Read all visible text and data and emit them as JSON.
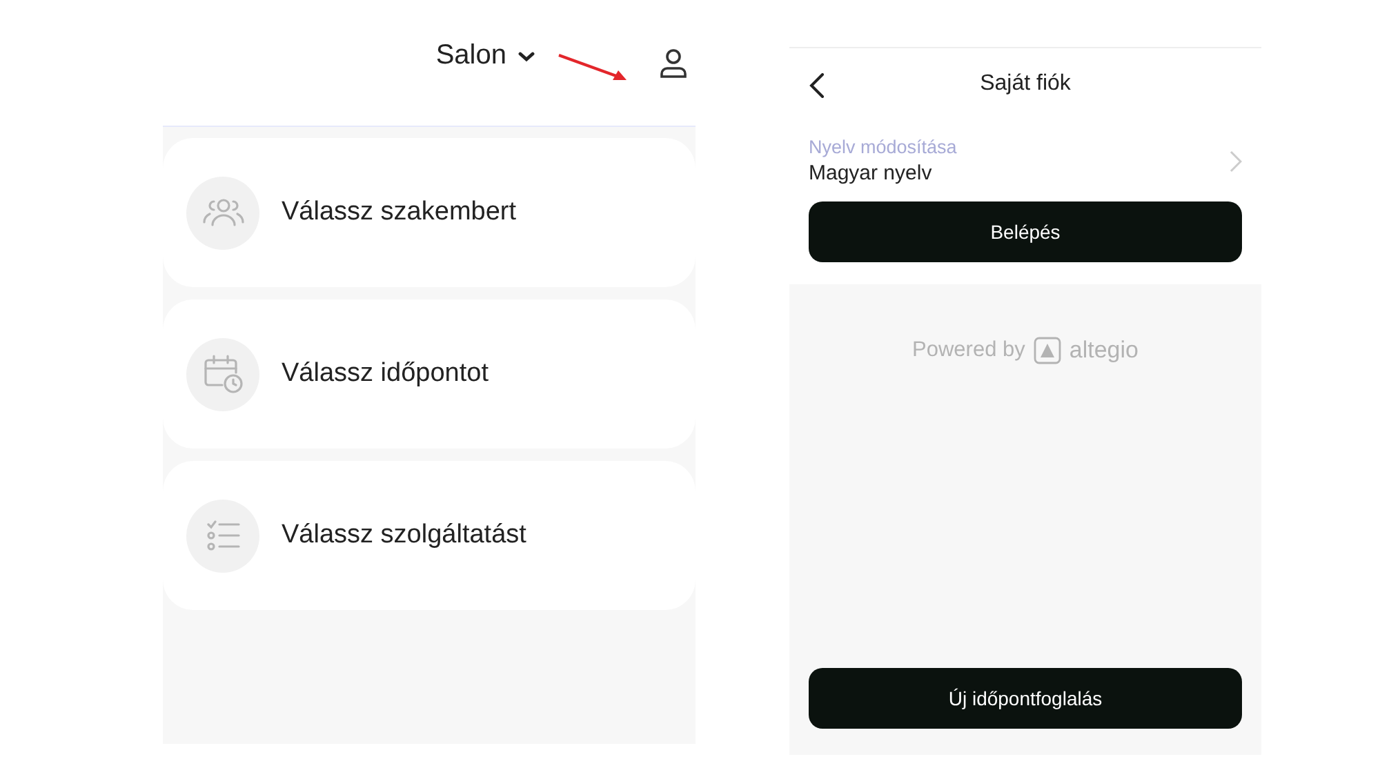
{
  "booking_screen": {
    "salon_selector": {
      "label": "Salon"
    },
    "options": [
      {
        "kind": "specialist",
        "label": "Válassz szakembert"
      },
      {
        "kind": "time",
        "label": "Válassz időpontot"
      },
      {
        "kind": "service",
        "label": "Válassz szolgáltatást"
      }
    ]
  },
  "account_screen": {
    "title": "Saját fiók",
    "language": {
      "label": "Nyelv módosítása",
      "value": "Magyar nyelv"
    },
    "login_button": "Belépés",
    "powered_by": {
      "text": "Powered by",
      "brand": "altegio"
    },
    "new_booking_button": "Új időpontfoglalás"
  }
}
